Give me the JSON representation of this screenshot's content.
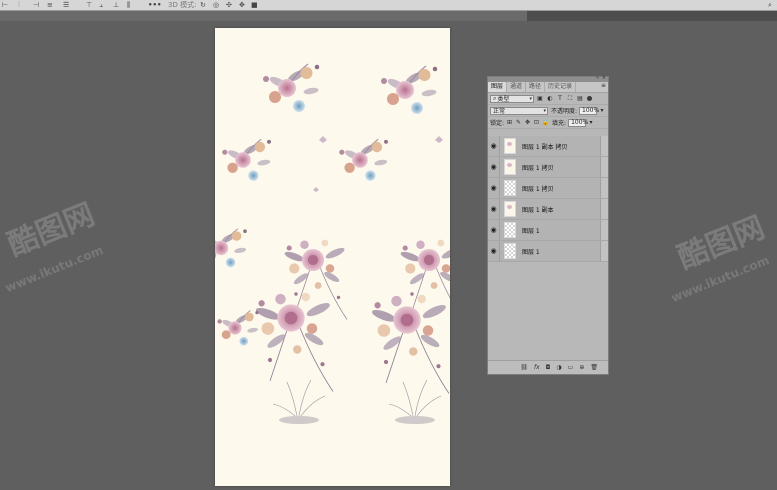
{
  "options_bar": {
    "mode_3d_label": "3D 模式:",
    "more_label": "•••"
  },
  "panel": {
    "tabs": [
      {
        "label": "图层",
        "active": true
      },
      {
        "label": "通道",
        "active": false
      },
      {
        "label": "路径",
        "active": false
      },
      {
        "label": "历史记录",
        "active": false
      }
    ],
    "filter_select": "类型",
    "blend_mode": "正常",
    "opacity_label": "不透明度:",
    "opacity_value": "100%",
    "lock_label": "锁定:",
    "fill_label": "填充:",
    "fill_value": "100%",
    "layers": [
      {
        "name": "图层 1 副本 拷贝",
        "visible": true
      },
      {
        "name": "图层 1 拷贝",
        "visible": true
      },
      {
        "name": "图层 1 拷贝",
        "visible": true
      },
      {
        "name": "图层 1 副本",
        "visible": true
      },
      {
        "name": "图层 1",
        "visible": true
      },
      {
        "name": "图层 1",
        "visible": true
      }
    ]
  },
  "watermark": {
    "logo_text": "酷图网",
    "url_text": "www.ikutu.com"
  },
  "colors": {
    "workspace": "#5f5f5f",
    "canvas": "#fdf9ec",
    "panel": "#b8b8b8",
    "rose": "#c98ca6",
    "leaf": "#8e7b96",
    "blue": "#8fb8d2"
  }
}
